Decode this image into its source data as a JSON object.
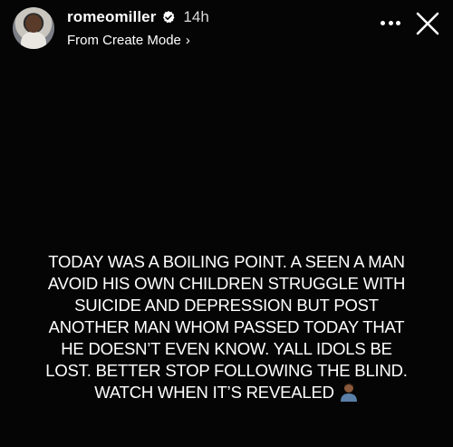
{
  "header": {
    "username": "romeomiller",
    "time": "14h",
    "subtitle": "From Create Mode",
    "subtitle_chevron": "›"
  },
  "icons": {
    "verified": "verified-badge-icon",
    "more": "more-options-icon",
    "close": "close-icon",
    "emoji": "man-emoji-icon"
  },
  "story": {
    "lines": [
      "TODAY WAS A BOILING POINT. A SEEN A MAN",
      "AVOID HIS OWN CHILDREN STRUGGLE WITH",
      "SUICIDE AND DEPRESSION BUT POST",
      "ANOTHER MAN WHOM PASSED TODAY THAT",
      "HE DOESN’T EVEN KNOW. YALL IDOLS BE",
      "LOST. BETTER STOP FOLLOWING THE BLIND.",
      "WATCH WHEN IT’S REVEALED"
    ]
  },
  "colors": {
    "background": "#000000",
    "text": "#ffffff",
    "time_text": "#d9d9d9"
  }
}
